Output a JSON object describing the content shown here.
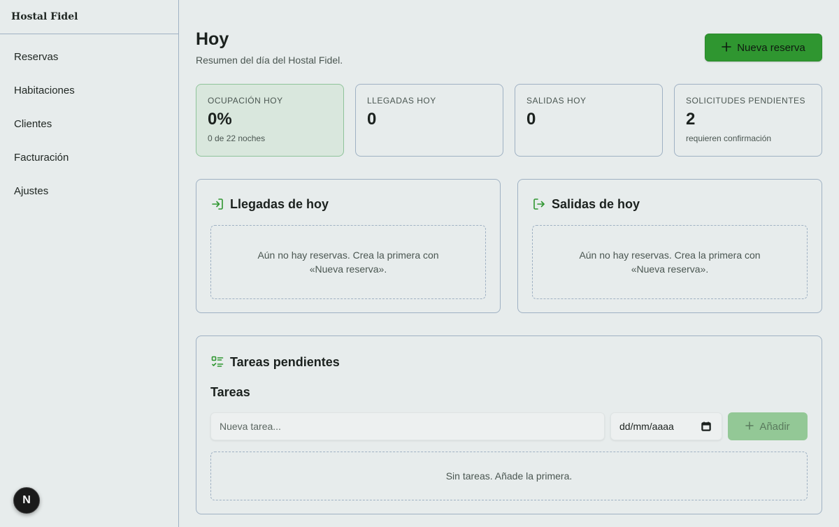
{
  "sidebar": {
    "brand": "Hostal Fidel",
    "items": [
      {
        "label": "Reservas"
      },
      {
        "label": "Habitaciones"
      },
      {
        "label": "Clientes"
      },
      {
        "label": "Facturación"
      },
      {
        "label": "Ajustes"
      }
    ],
    "badge": "N"
  },
  "header": {
    "title": "Hoy",
    "subtitle": "Resumen del día del Hostal Fidel.",
    "new_booking_label": "Nueva reserva",
    "new_booking_icon": "plus-icon"
  },
  "stats": [
    {
      "label": "OCUPACIÓN HOY",
      "value": "0%",
      "sub": "0 de 22 noches"
    },
    {
      "label": "LLEGADAS HOY",
      "value": "0",
      "sub": ""
    },
    {
      "label": "SALIDAS HOY",
      "value": "0",
      "sub": ""
    },
    {
      "label": "SOLICITUDES PENDIENTES",
      "value": "2",
      "sub": "requieren confirmación"
    }
  ],
  "arrivals": {
    "title": "Llegadas de hoy",
    "icon": "log-in-icon",
    "empty_text": "Aún no hay reservas. Crea la primera con «Nueva reserva»."
  },
  "departures": {
    "title": "Salidas de hoy",
    "icon": "log-out-icon",
    "empty_text": "Aún no hay reservas. Crea la primera con «Nueva reserva»."
  },
  "tasks": {
    "title": "Tareas pendientes",
    "icon": "checklist-icon",
    "subtitle": "Tareas",
    "input_placeholder": "Nueva tarea...",
    "date_placeholder": "dd/mm/aaaa",
    "add_label": "Añadir",
    "empty_text": "Sin tareas. Añade la primera."
  },
  "colors": {
    "accent": "#2f9630",
    "accent_disabled": "#93c896",
    "background": "#e7ecec",
    "border": "#9fb1c3",
    "highlight_card": "#d9e7dd"
  }
}
